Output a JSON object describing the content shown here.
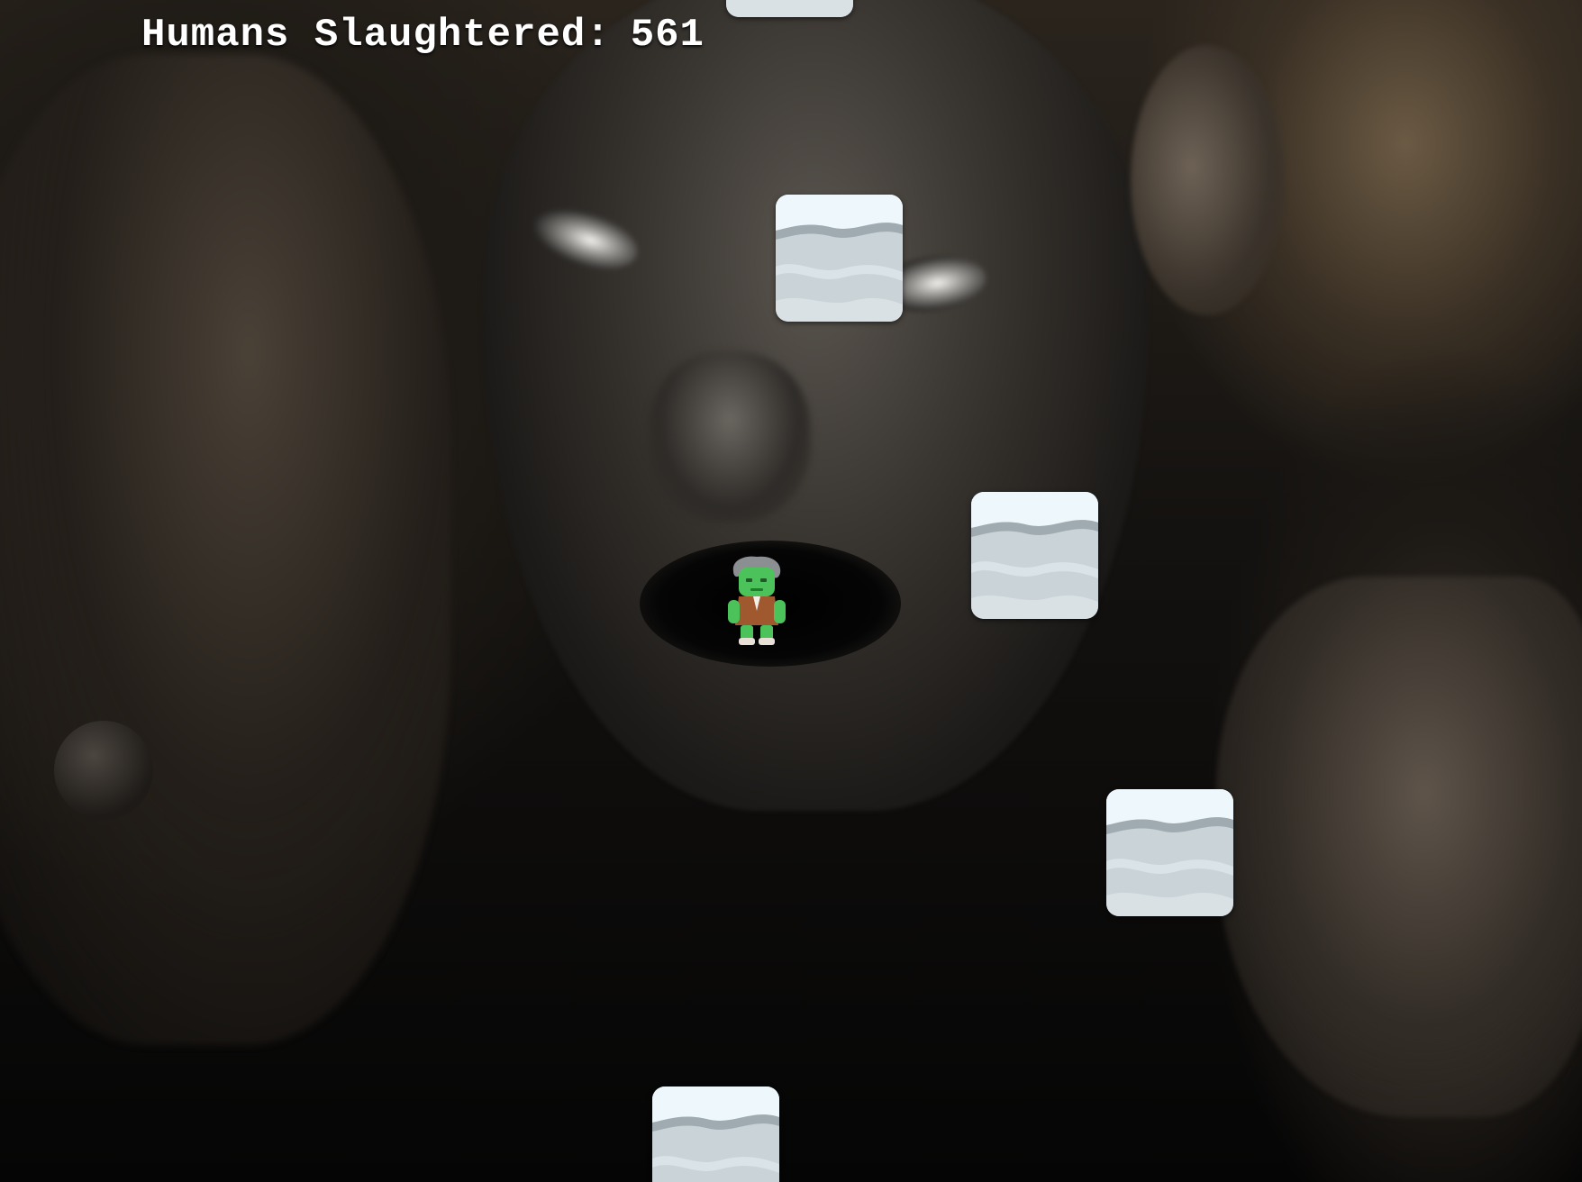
{
  "hud": {
    "score_label": "Humans Slaughtered:",
    "score_value": "561"
  },
  "scene": {
    "background": "dark zombie face artwork",
    "platform_type": "ice-block",
    "platform_count": 5,
    "player": "green zombie with gray hair and brown jacket"
  },
  "colors": {
    "hud_text": "#ffffff",
    "ice_top": "#eef7fb",
    "ice_body": "#c9d3d8",
    "ice_wave": "#9fabb1",
    "zombie_skin": "#4cc35a",
    "zombie_hair": "#8c8f92",
    "zombie_jacket": "#a0582e"
  }
}
